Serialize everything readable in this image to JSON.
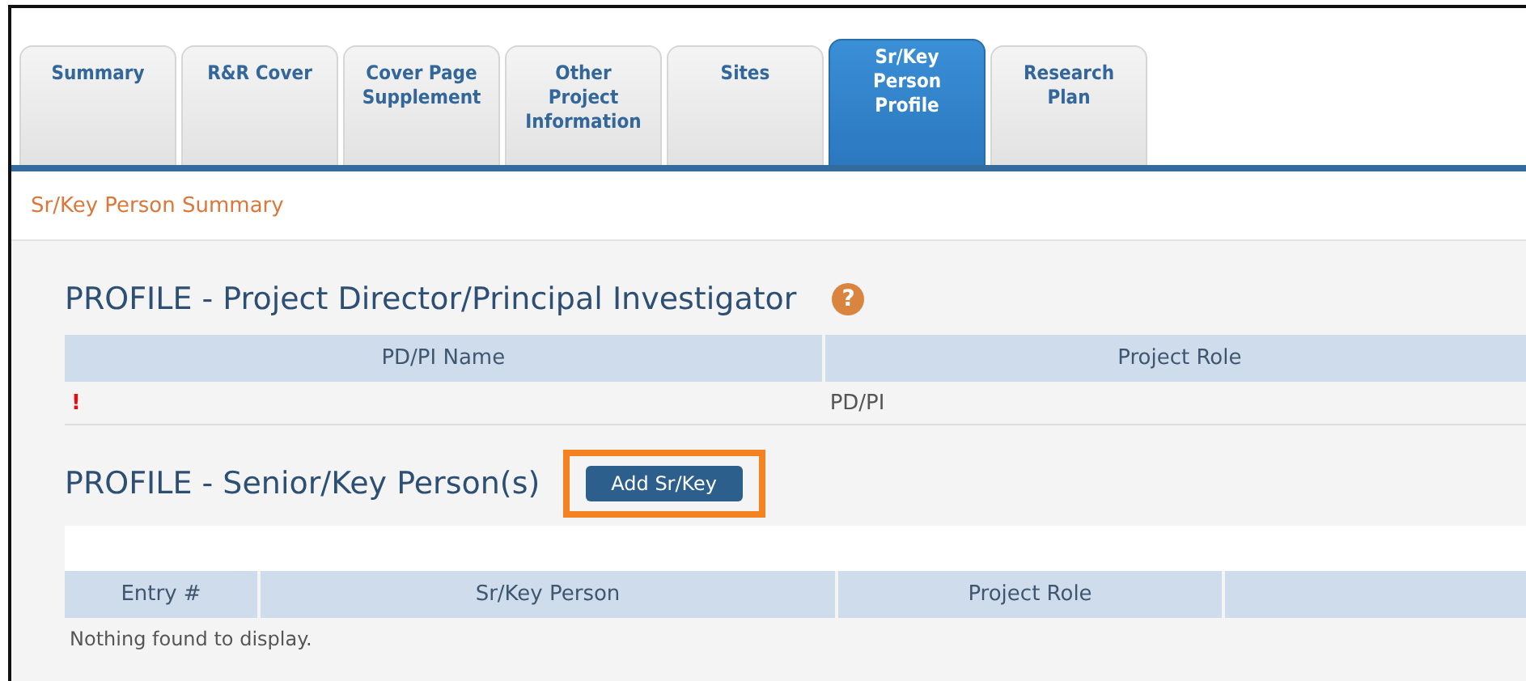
{
  "tabs": [
    {
      "label": "Summary",
      "selected": false
    },
    {
      "label": "R&R Cover",
      "selected": false
    },
    {
      "label": "Cover Page\nSupplement",
      "selected": false
    },
    {
      "label": "Other\nProject\nInformation",
      "selected": false
    },
    {
      "label": "Sites",
      "selected": false
    },
    {
      "label": "Sr/Key\nPerson\nProfile",
      "selected": true
    },
    {
      "label": "Research\nPlan",
      "selected": false
    }
  ],
  "breadcrumb": "Sr/Key Person Summary",
  "pi_section": {
    "title": "PROFILE - Project Director/Principal Investigator",
    "help_icon": "?",
    "columns": [
      "PD/PI Name",
      "Project Role"
    ],
    "rows": [
      {
        "cells": [
          {
            "kind": "alert",
            "text": "!"
          },
          {
            "kind": "text",
            "text": "PD/PI"
          }
        ]
      }
    ]
  },
  "senior_section": {
    "title": "PROFILE - Senior/Key Person(s)",
    "add_button": {
      "label": "Add Sr/Key",
      "highlighted": true
    },
    "columns": [
      "Entry #",
      "Sr/Key Person",
      "Project Role"
    ],
    "empty_message": "Nothing found to display."
  }
}
